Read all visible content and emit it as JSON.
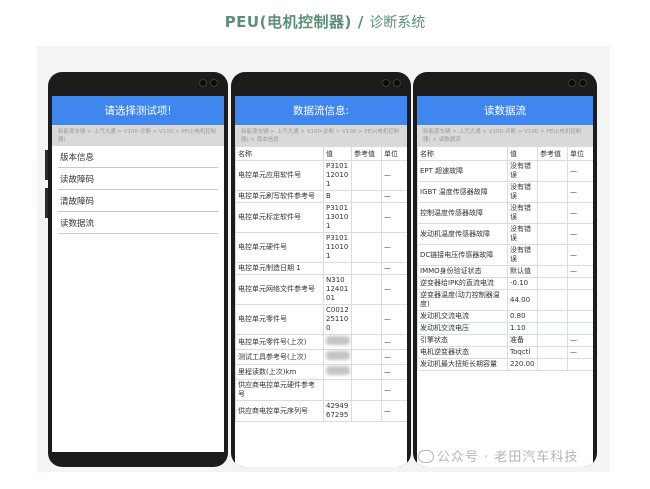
{
  "title": {
    "brand": "PEU(电机控制器)",
    "slash": "/",
    "subtitle": "诊断系统"
  },
  "phone1": {
    "header": "请选择测试项!",
    "subheader": "新能源车辆 > 上汽大通 > V100-诊断 > V100 > PEU(电机控制器)",
    "menu": [
      "版本信息",
      "读故障码",
      "清故障码",
      "读数据流"
    ]
  },
  "phone2": {
    "header": "数据流信息:",
    "subheader": "新能源车辆 > 上汽大通 > V100-诊断 > V100 > PEU(电机控制器) > 版本信息",
    "columns": [
      "名称",
      "值",
      "参考值",
      "单位"
    ],
    "rows": [
      {
        "name": "电控单元应用软件号",
        "value": "P3101120101",
        "ref": "",
        "unit": "—"
      },
      {
        "name": "电控单元刷写软件参考号",
        "value": "B",
        "ref": "",
        "unit": "—"
      },
      {
        "name": "电控单元标定软件号",
        "value": "P3101130101",
        "ref": "",
        "unit": "—"
      },
      {
        "name": "电控单元硬件号",
        "value": "P3101110101",
        "ref": "",
        "unit": "—"
      },
      {
        "name": "电控单元制造日期 1",
        "value": "",
        "ref": "",
        "unit": "—"
      },
      {
        "name": "电控单元网络文件参考号",
        "value": "N3101240101",
        "ref": "",
        "unit": "—"
      },
      {
        "name": "电控单元零件号",
        "value": "C0012251100",
        "ref": "",
        "unit": "—"
      },
      {
        "name": "电控单元零件号(上次)",
        "value": "",
        "ref": "",
        "unit": "—"
      },
      {
        "name": "测试工具参考号(上次)",
        "value": "",
        "ref": "",
        "unit": "—"
      },
      {
        "name": "里程读数(上次)km",
        "value": "",
        "ref": "",
        "unit": "—"
      },
      {
        "name": "供应商电控单元硬件参考号",
        "value": "",
        "ref": "",
        "unit": "—"
      },
      {
        "name": "供应商电控单元序列号",
        "value": "4294967295",
        "ref": "",
        "unit": "—"
      }
    ]
  },
  "phone3": {
    "header": "读数据流",
    "subheader": "新能源车辆 > 上汽大通 > V100-诊断 > V100 > PEU(电机控制器) > 读数据流",
    "columns": [
      "名称",
      "值",
      "参考值",
      "单位"
    ],
    "rows": [
      {
        "name": "EPT 超速故障",
        "value": "没有错误",
        "ref": "",
        "unit": "—"
      },
      {
        "name": "IGBT 温度传感器故障",
        "value": "没有错误",
        "ref": "",
        "unit": "—"
      },
      {
        "name": "控制温度传感器故障",
        "value": "没有错误",
        "ref": "",
        "unit": "—"
      },
      {
        "name": "发动机温度传感器故障",
        "value": "没有错误",
        "ref": "",
        "unit": "—"
      },
      {
        "name": "DC链接电压传感器故障",
        "value": "没有错误",
        "ref": "",
        "unit": "—"
      },
      {
        "name": "IMMO身份验证状态",
        "value": "默认值",
        "ref": "",
        "unit": "—"
      },
      {
        "name": "逆变器给IPK的直流电流",
        "value": "-0.10",
        "ref": "",
        "unit": ""
      },
      {
        "name": "逆变器温度(动力控制器温度)",
        "value": "44.00",
        "ref": "",
        "unit": ""
      },
      {
        "name": "发动机交流电流",
        "value": "0.80",
        "ref": "",
        "unit": ""
      },
      {
        "name": "发动机交流电压",
        "value": "1.10",
        "ref": "",
        "unit": ""
      },
      {
        "name": "引擎状态",
        "value": "准备",
        "ref": "",
        "unit": "—"
      },
      {
        "name": "电机逆变器状态",
        "value": "Toqctl",
        "ref": "",
        "unit": "—"
      },
      {
        "name": "发动机最大扭矩长期容量",
        "value": "220.00",
        "ref": "",
        "unit": ""
      }
    ]
  },
  "watermark": "公众号 · 老田汽车科技"
}
